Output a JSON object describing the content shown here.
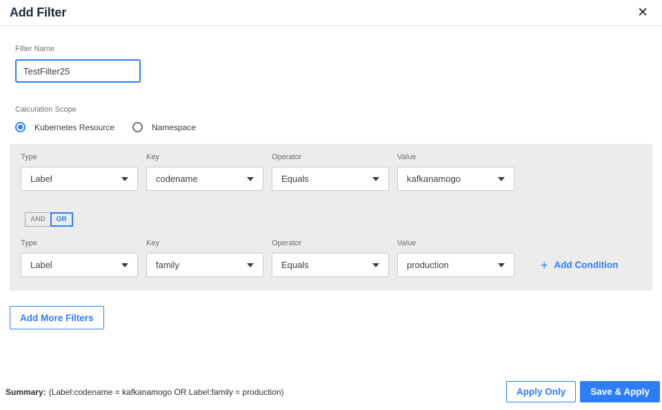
{
  "dialog": {
    "title": "Add Filter",
    "close_icon": "✕"
  },
  "filter_name": {
    "label": "Filter Name",
    "value": "TestFilter25"
  },
  "calculation_scope": {
    "label": "Calculation Scope",
    "options": [
      {
        "label": "Kubernetes Resource",
        "selected": true
      },
      {
        "label": "Namespace",
        "selected": false
      }
    ]
  },
  "conditions": {
    "field_labels": {
      "type": "Type",
      "key": "Key",
      "operator": "Operator",
      "value": "Value"
    },
    "rows": [
      {
        "type": "Label",
        "key": "codename",
        "operator": "Equals",
        "value": "kafkanamogo"
      },
      {
        "type": "Label",
        "key": "family",
        "operator": "Equals",
        "value": "production"
      }
    ],
    "logic_toggle": {
      "and_label": "AND",
      "or_label": "OR",
      "selected": "OR"
    },
    "add_condition": {
      "plus_icon": "+",
      "label": "Add Condition"
    }
  },
  "add_more_filters_label": "Add More Filters",
  "summary": {
    "label": "Summary:",
    "text": "(Label:codename = kafkanamogo OR Label:family = production)"
  },
  "footer": {
    "apply_only_label": "Apply Only",
    "save_apply_label": "Save & Apply"
  },
  "colors": {
    "accent_blue": "#2e7df6",
    "panel_gray": "#ececec",
    "title_dark": "#1e2b3c"
  }
}
